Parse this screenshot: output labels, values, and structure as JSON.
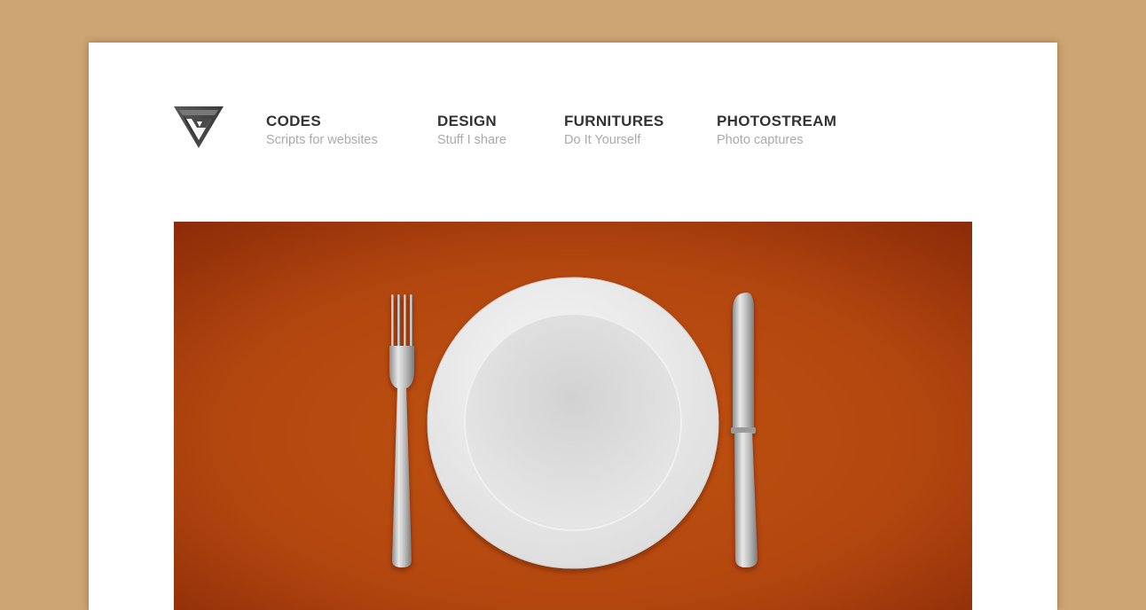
{
  "logo": {
    "icon": "triangle-logo-icon"
  },
  "nav": {
    "items": [
      {
        "title": "CODES",
        "subtitle": "Scripts for websites"
      },
      {
        "title": "DESIGN",
        "subtitle": "Stuff I share"
      },
      {
        "title": "FURNITURES",
        "subtitle": "Do It Yourself"
      },
      {
        "title": "PHOTOSTREAM",
        "subtitle": "Photo captures"
      }
    ]
  },
  "hero": {
    "image": "place-setting-illustration",
    "colors": {
      "background": "#b2460f",
      "plate": "#e8e8e8",
      "cutlery": "#c9c9c9"
    }
  },
  "colors": {
    "page_background": "#cda473",
    "card": "#ffffff",
    "nav_title": "#333333",
    "nav_subtitle": "#aaaaaa"
  }
}
